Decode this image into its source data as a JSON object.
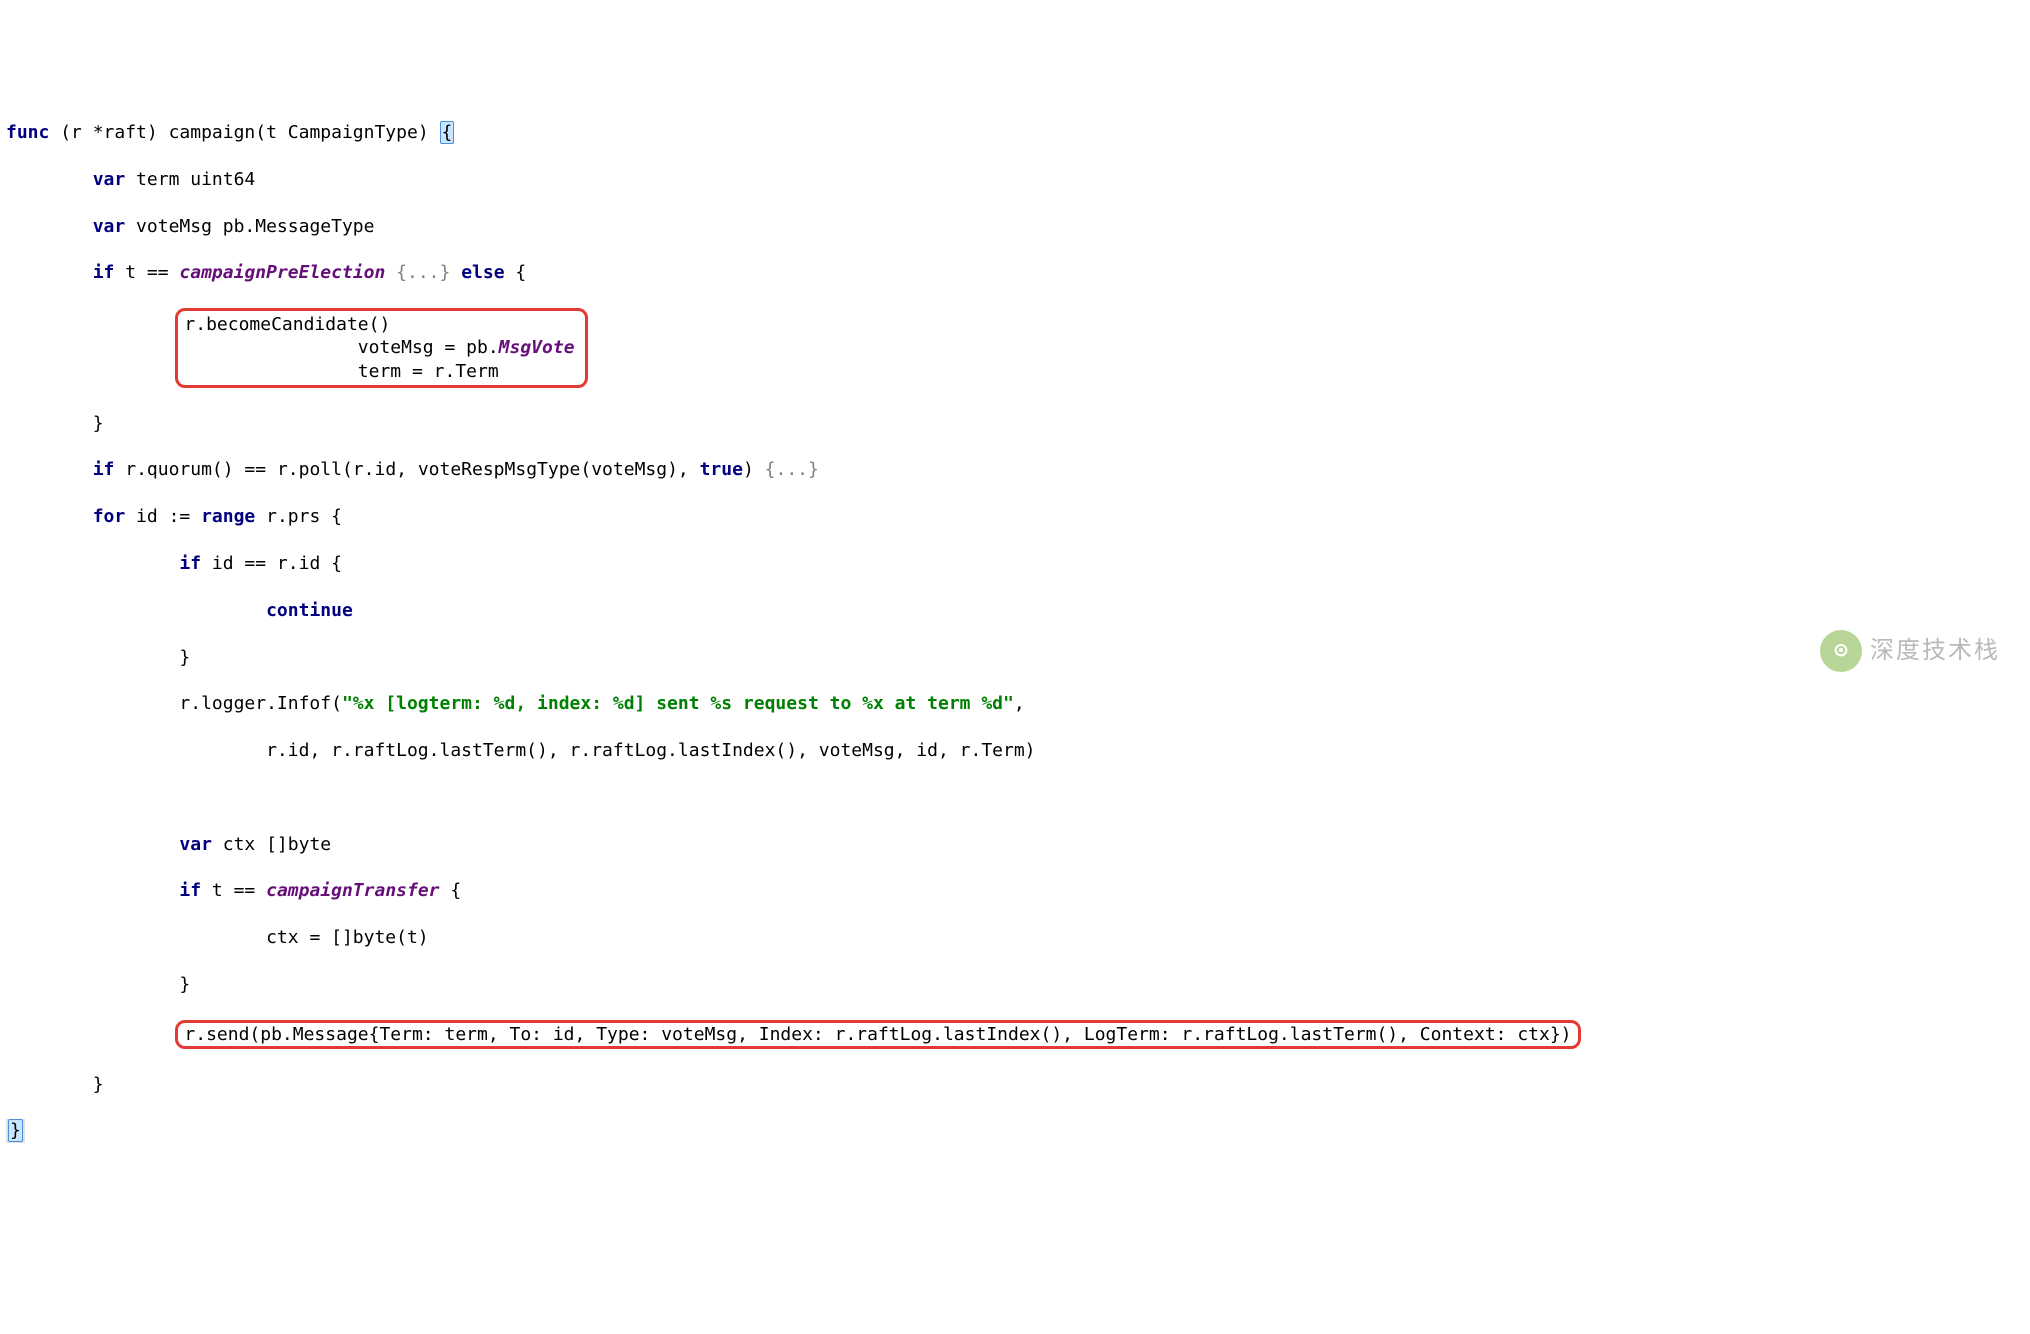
{
  "code": {
    "l1_func": "func",
    "l1_sig": " (r *raft) campaign(t CampaignType) ",
    "l1_brace": "{",
    "l2_indent": "        ",
    "l2_var": "var",
    "l2_rest": " term uint64",
    "l3_indent": "        ",
    "l3_var": "var",
    "l3_rest": " voteMsg pb.MessageType",
    "l4_indent": "        ",
    "l4_if": "if",
    "l4_mid": " t == ",
    "l4_ident": "campaignPreElection",
    "l4_sp": " ",
    "l4_fold": "{...}",
    "l4_else": " else ",
    "l4_brace": "{",
    "l5_indent": "                ",
    "l5_text": "r.becomeCandidate()",
    "l6_indent": "                ",
    "l6_a": "voteMsg = pb.",
    "l6_ident": "MsgVote",
    "l7_indent": "                ",
    "l7_text": "term = r.Term",
    "l8_indent": "        ",
    "l8_brace": "}",
    "l9_indent": "        ",
    "l9_if": "if",
    "l9_mid": " r.quorum() == r.poll(r.id, voteRespMsgType(voteMsg), ",
    "l9_true": "true",
    "l9_close": ") ",
    "l9_fold": "{...}",
    "l10_indent": "        ",
    "l10_for": "for",
    "l10_mid": " id := ",
    "l10_range": "range",
    "l10_rest": " r.prs {",
    "l11_indent": "                ",
    "l11_if": "if",
    "l11_rest": " id == r.id {",
    "l12_indent": "                        ",
    "l12_cont": "continue",
    "l13_indent": "                ",
    "l13_brace": "}",
    "l14_indent": "                ",
    "l14_a": "r.logger.Infof(",
    "l14_str": "\"%x [logterm: %d, index: %d] sent %s request to %x at term %d\"",
    "l14_comma": ",",
    "l15_indent": "                        ",
    "l15_text": "r.id, r.raftLog.lastTerm(), r.raftLog.lastIndex(), voteMsg, id, r.Term)",
    "l16_indent": "                ",
    "l17_indent": "                ",
    "l17_var": "var",
    "l17_rest": " ctx []byte",
    "l18_indent": "                ",
    "l18_if": "if",
    "l18_mid": " t == ",
    "l18_ident": "campaignTransfer",
    "l18_brace": " {",
    "l19_indent": "                        ",
    "l19_text": "ctx = []byte(t)",
    "l20_indent": "                ",
    "l20_brace": "}",
    "l21_indent": "                ",
    "l21_text": "r.send(pb.Message{Term: term, To: id, Type: voteMsg, Index: r.raftLog.lastIndex(), LogTerm: r.raftLog.lastTerm(), Context: ctx})",
    "l22_indent": "        ",
    "l22_brace": "}",
    "l23_brace": "}"
  },
  "watermark": {
    "icon": "⊙",
    "text": "深度技术栈"
  }
}
